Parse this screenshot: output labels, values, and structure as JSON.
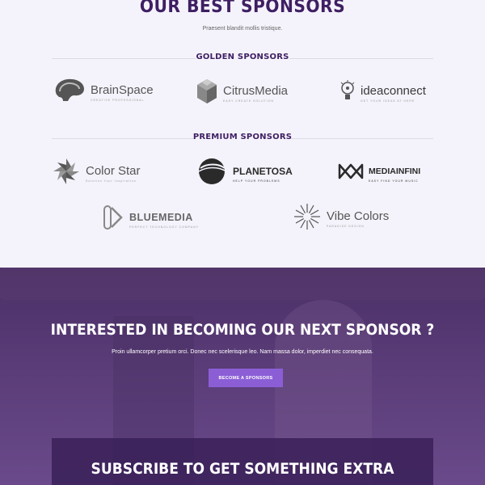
{
  "header": {
    "title": "OUR BEST SPONSORS",
    "subtitle": "Praesent blandit mollis tristique."
  },
  "golden": {
    "label": "GOLDEN SPONSORS",
    "logos": [
      {
        "name": "BrainSpace",
        "tag": "CREATIVE PROFESSIONAL",
        "icon": "brain-icon"
      },
      {
        "name": "CitrusMedia",
        "tag": "EASY CREATE SOLUTION",
        "icon": "cube-icon"
      },
      {
        "name": "ideaconnect",
        "tag": "GET YOUR IDEAS AT HERE",
        "icon": "lightbulb-icon"
      }
    ]
  },
  "premium": {
    "label": "PREMIUM SPONSORS",
    "logos": [
      {
        "name": "Color Star",
        "tag": "Solution Your Inspiration",
        "icon": "star-swirl-icon"
      },
      {
        "name": "PLANETOSA",
        "tag": "HELP YOUR PROBLEMS",
        "icon": "planet-icon"
      },
      {
        "name": "MEDIAINFINI",
        "tag": "EASY FIND YOUR MUSIC",
        "icon": "infinity-icon"
      },
      {
        "name": "BLUEMEDIA",
        "tag": "PERFECT TECHNOLOGY COMPANY",
        "icon": "bm-icon"
      },
      {
        "name": "Vibe Colors",
        "tag": "PARADISE DESIGN",
        "icon": "sunburst-icon"
      }
    ]
  },
  "cta": {
    "title": "INTERESTED IN BECOMING OUR NEXT SPONSOR ?",
    "text": "Proin ullamcorper pretium orci. Donec nec scelerisque leo. Nam massa dolor, imperdiet nec consequata.",
    "button": "BECOME A SPONSORS"
  },
  "subscribe": {
    "title": "SUBSCRIBE TO GET SOMETHING EXTRA"
  },
  "colors": {
    "brand": "#3f1f63",
    "button": "#8b5ed6",
    "cta_bg": "#5a3c78"
  }
}
